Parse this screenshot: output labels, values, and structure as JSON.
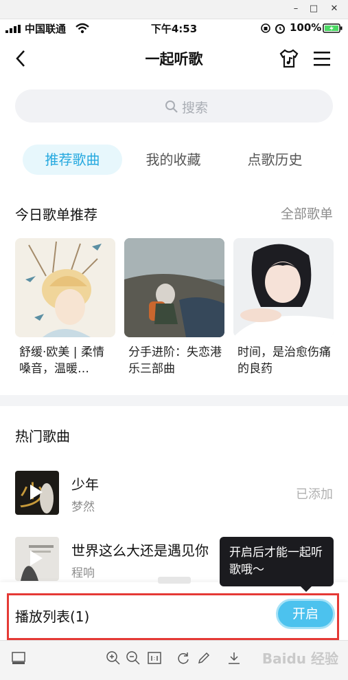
{
  "window": {
    "minimize": "–",
    "maximize": "□",
    "close": "✕"
  },
  "status_bar": {
    "carrier": "中国联通",
    "time": "下午4:53",
    "battery": "100%"
  },
  "header": {
    "title": "一起听歌"
  },
  "search": {
    "placeholder": "搜索"
  },
  "tabs": [
    {
      "label": "推荐歌曲",
      "active": true
    },
    {
      "label": "我的收藏",
      "active": false
    },
    {
      "label": "点歌历史",
      "active": false
    }
  ],
  "playlists_section": {
    "title": "今日歌单推荐",
    "more": "全部歌单"
  },
  "playlists": [
    {
      "name": "舒缓·欧美 | 柔情嗓音，温暖…"
    },
    {
      "name": "分手进阶：失恋港乐三部曲"
    },
    {
      "name": "时间，是治愈伤痛的良药"
    }
  ],
  "hot_section": {
    "title": "热门歌曲"
  },
  "songs": [
    {
      "title": "少年",
      "artist": "梦然",
      "status": "已添加"
    },
    {
      "title": "世界这么大还是遇见你",
      "artist": "程响",
      "status": ""
    }
  ],
  "tooltip": {
    "text": "开启后才能一起听歌哦～"
  },
  "playlist_bar": {
    "label": "播放列表(1)",
    "button": "开启"
  },
  "viewer_toolbar": {
    "watermark": "Baidu 经验"
  },
  "colors": {
    "accent": "#26a9df",
    "button": "#4cc2ee",
    "highlight": "#e53935"
  }
}
